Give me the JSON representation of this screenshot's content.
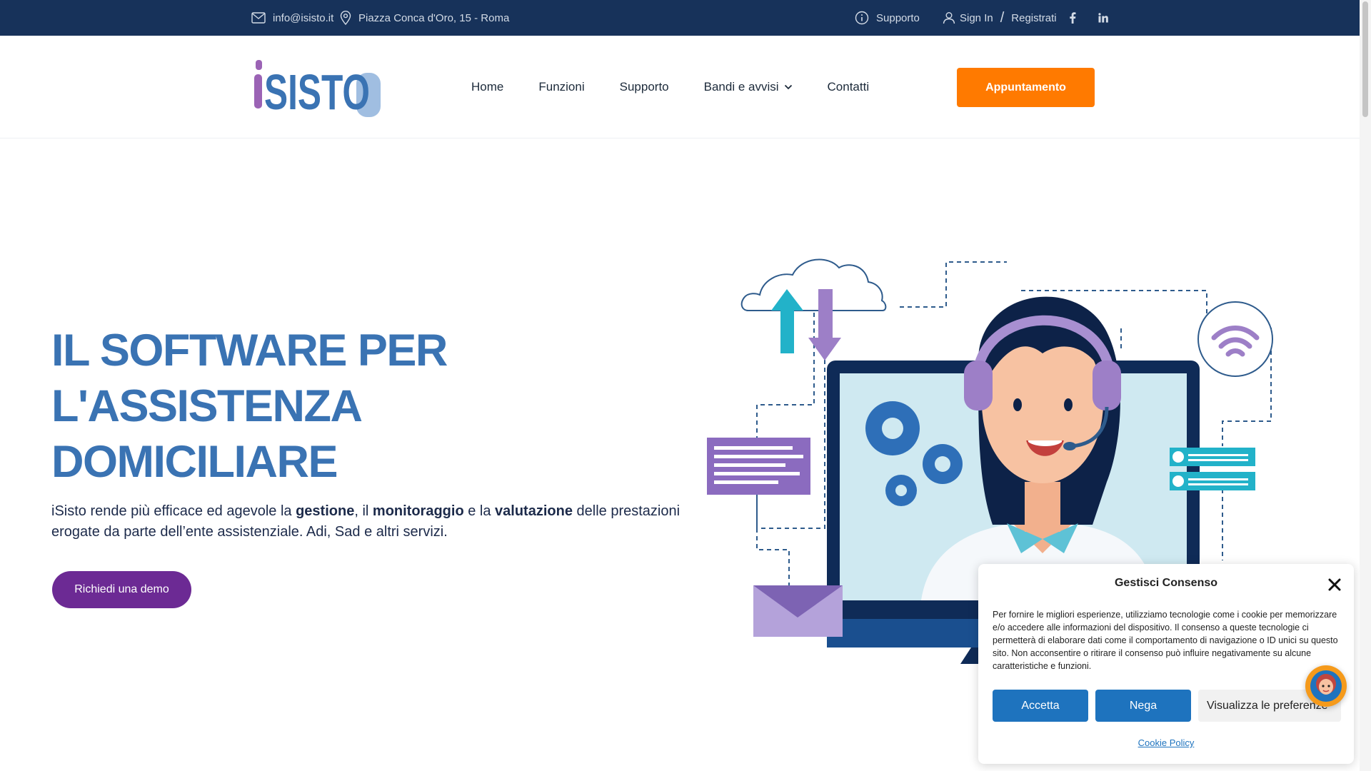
{
  "topbar": {
    "email": "info@isisto.it",
    "address": "Piazza Conca d'Oro, 15 - Roma",
    "support": "Supporto",
    "sign_in": "Sign In",
    "separator": "/",
    "register": "Registrati",
    "social": [
      "facebook-icon",
      "linkedin-icon"
    ]
  },
  "header": {
    "logo_text": "iSISTO",
    "nav": [
      "Home",
      "Funzioni",
      "Supporto",
      "Bandi e avvisi",
      "Contatti"
    ],
    "cta": "Appuntamento"
  },
  "hero": {
    "title_lines": [
      "IL SOFTWARE PER",
      "L'ASSISTENZA",
      "DOMICILIARE"
    ],
    "sub": {
      "t1": "iSisto rende più efficace ed agevole la ",
      "b1": "gestione",
      "t2": ", il ",
      "b2": "monitoraggio",
      "t3": " e la ",
      "b3": "valutazione",
      "t4": " delle prestazioni erogate da parte dell’ente assistenziale. Adi, Sad e altri servizi."
    },
    "demo_button": "Richiedi una demo"
  },
  "cookie": {
    "title": "Gestisci Consenso",
    "text": "Per fornire le migliori esperienze, utilizziamo tecnologie come i cookie per memorizzare e/o accedere alle informazioni del dispositivo. Il consenso a queste tecnologie ci permetterà di elaborare dati come il comportamento di navigazione o ID unici su questo sito. Non acconsentire o ritirare il consenso può influire negativamente su alcune caratteristiche e funzioni.",
    "accept": "Accetta",
    "deny": "Nega",
    "preferences": "Visualizza le preferenze",
    "policy_link": "Cookie Policy"
  },
  "colors": {
    "topbar": "#17325a",
    "accent_orange": "#ff7a00",
    "title_blue": "#3a73b3",
    "demo_purple": "#6c2a94",
    "cookie_blue": "#1e73be"
  }
}
